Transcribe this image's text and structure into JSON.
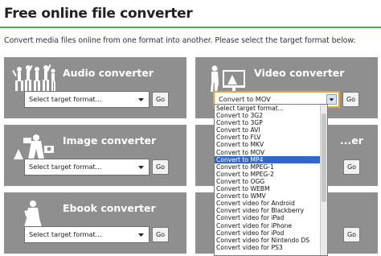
{
  "page": {
    "title": "Free online file converter",
    "intro": "Convert media files online from one format into another. Please select the target format below:",
    "accent_color": "#4caf50"
  },
  "cards": {
    "audio": {
      "title": "Audio converter",
      "select_value": "Select target format...",
      "go_label": "Go",
      "icon": "people-jumping-icon"
    },
    "video": {
      "title": "Video converter",
      "select_value": "Convert to MOV",
      "go_label": "Go",
      "icon": "person-at-screen-icon"
    },
    "image": {
      "title": "Image converter",
      "select_value": "Select target format...",
      "go_label": "Go",
      "icon": "photographer-icon"
    },
    "doc": {
      "title_visible": "...er",
      "go_label": "Go"
    },
    "ebook": {
      "title": "Ebook converter",
      "select_value": "Select target format...",
      "go_label": "Go",
      "icon": "reader-icon"
    },
    "archive": {
      "go_label": "Go"
    }
  },
  "dropdown": {
    "options": [
      "Select target format...",
      "Convert to 3G2",
      "Convert to 3GP",
      "Convert to AVI",
      "Convert to FLV",
      "Convert to MKV",
      "Convert to MOV",
      "Convert to MP4",
      "Convert to MPEG-1",
      "Convert to MPEG-2",
      "Convert to OGG",
      "Convert to WEBM",
      "Convert to WMV",
      "Convert video for Android",
      "Convert video for Blackberry",
      "Convert video for iPad",
      "Convert video for iPhone",
      "Convert video for iPod",
      "Convert video for Nintendo DS",
      "Convert video for PS3"
    ],
    "highlighted": "Convert to MP4",
    "highlight_color": "#3366cc"
  }
}
